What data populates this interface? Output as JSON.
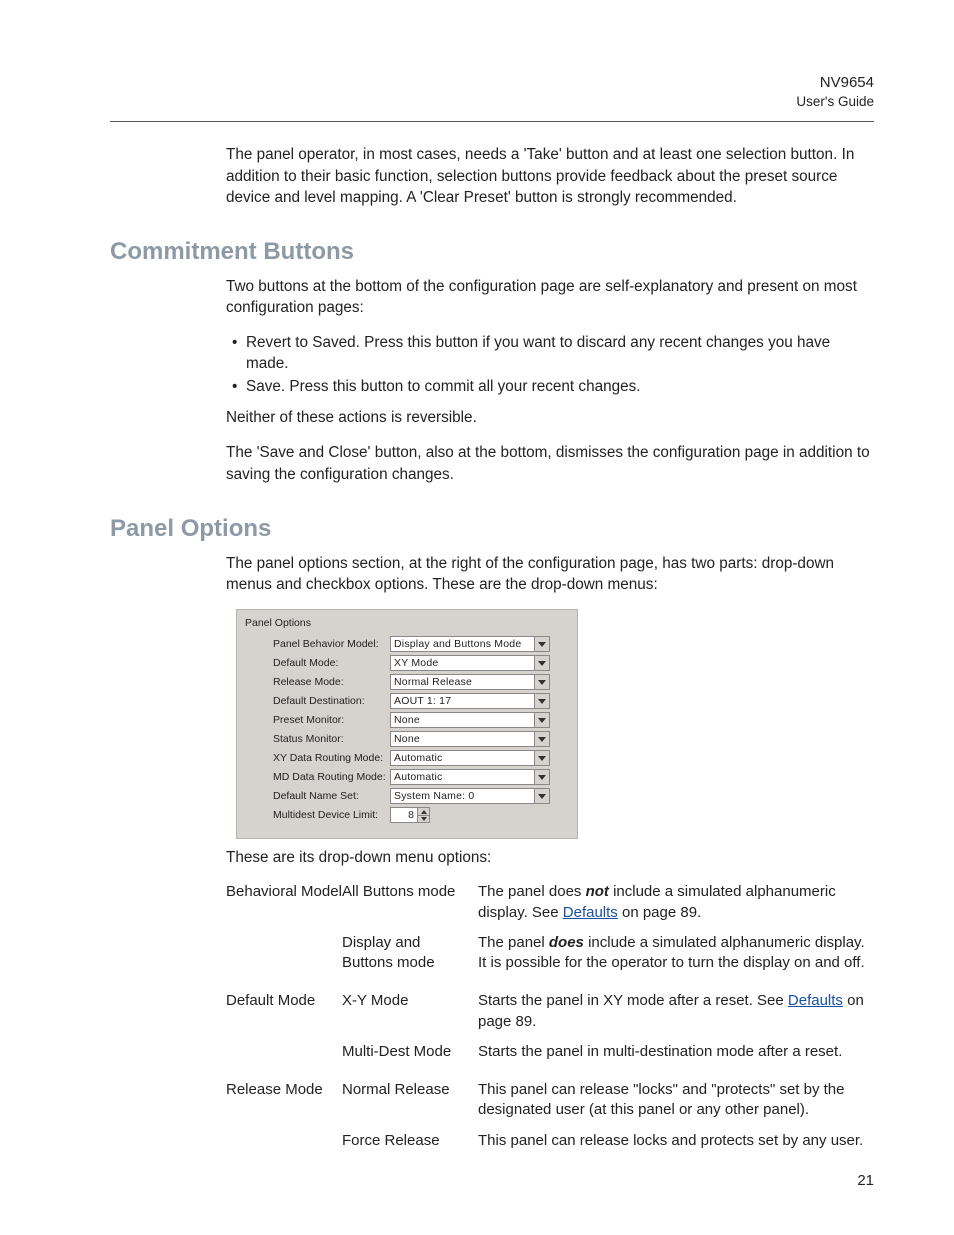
{
  "header": {
    "title": "NV9654",
    "subtitle": "User's Guide"
  },
  "intro": "The panel operator, in most cases, needs a 'Take' button and at least one selection button. In addition to their basic function, selection buttons provide feedback about the preset source device and level mapping. A 'Clear Preset' button is strongly recommended.",
  "commitment": {
    "heading": "Commitment Buttons",
    "p1": "Two buttons at the bottom of the configuration page are self-explanatory and present on most configuration pages:",
    "bullets": [
      "Revert to Saved. Press this button if you want to discard any recent changes you have made.",
      "Save. Press this button to commit all your recent changes."
    ],
    "p2": "Neither of these actions is reversible.",
    "p3": "The 'Save and Close' button, also at the bottom, dismisses the configuration page in addition to saving the configuration changes."
  },
  "panelOptions": {
    "heading": "Panel Options",
    "intro": "The panel options section, at the right of the configuration page, has two parts: drop-down menus and checkbox options. These are the drop-down menus:",
    "boxTitle": "Panel Options",
    "fields": {
      "behaviorModel": {
        "label": "Panel Behavior Model:",
        "value": "Display and Buttons Mode"
      },
      "defaultMode": {
        "label": "Default Mode:",
        "value": "XY Mode"
      },
      "releaseMode": {
        "label": "Release Mode:",
        "value": "Normal Release"
      },
      "defaultDestination": {
        "label": "Default Destination:",
        "value": "AOUT 1: 17"
      },
      "presetMonitor": {
        "label": "Preset Monitor:",
        "value": "None"
      },
      "statusMonitor": {
        "label": "Status Monitor:",
        "value": "None"
      },
      "xyRouting": {
        "label": "XY Data Routing Mode:",
        "value": "Automatic"
      },
      "mdRouting": {
        "label": "MD Data Routing Mode:",
        "value": "Automatic"
      },
      "defaultNameSet": {
        "label": "Default Name Set:",
        "value": "System Name: 0"
      },
      "multidest": {
        "label": "Multidest Device Limit:",
        "value": "8"
      }
    },
    "afterBox": "These are its drop-down menu options:"
  },
  "optionsTable": {
    "behavioralModel": {
      "label": "Behavioral Model",
      "allButtons": {
        "label": "All Buttons mode",
        "pre": "The panel does ",
        "emph": "not",
        "post": " include a simulated alphanumeric display. See ",
        "link": "Defaults",
        "tail": " on page 89."
      },
      "displayButtons": {
        "label": "Display and Buttons mode",
        "pre": "The panel ",
        "emph": "does",
        "post": " include a simulated alphanumeric display. It is possible for the operator to turn the display on and off."
      }
    },
    "defaultMode": {
      "label": "Default Mode",
      "xy": {
        "label": "X-Y Mode",
        "pre": "Starts the panel in XY mode after a reset. See ",
        "link": "Defaults",
        "tail": " on page 89."
      },
      "multi": {
        "label": "Multi-Dest Mode",
        "text": "Starts the panel in multi-destination mode after a reset."
      }
    },
    "releaseMode": {
      "label": "Release Mode",
      "normal": {
        "label": "Normal Release",
        "text": "This panel can release \"locks\" and \"protects\" set by the designated user (at this panel or any other panel)."
      },
      "force": {
        "label": "Force Release",
        "text": "This panel can release locks and protects set by any user."
      }
    }
  },
  "pageNumber": "21"
}
